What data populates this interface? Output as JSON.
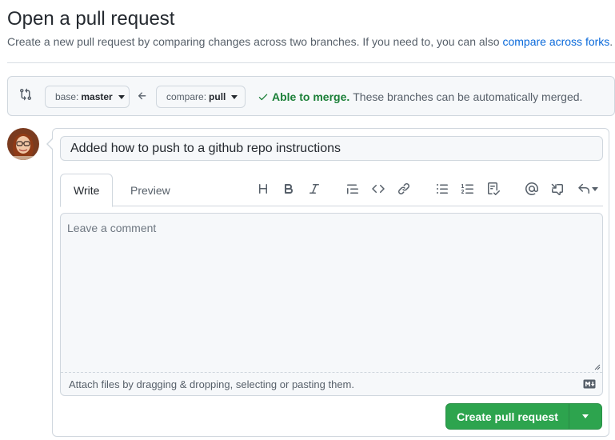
{
  "header": {
    "title": "Open a pull request",
    "subtitle": "Create a new pull request by comparing changes across two branches. If you need to, you can also ",
    "subtitle_link": "compare across forks",
    "subtitle_end": "."
  },
  "compare": {
    "base_prefix": "base: ",
    "base_branch": "master",
    "compare_prefix": "compare: ",
    "compare_branch": "pull",
    "merge_ok": "Able to merge.",
    "merge_detail": "These branches can be automatically merged."
  },
  "form": {
    "title_value": "Added how to push to a github repo instructions",
    "tabs": [
      "Write",
      "Preview"
    ],
    "comment_placeholder": "Leave a comment",
    "attach_text": "Attach files by dragging & dropping, selecting or pasting them.",
    "submit_label": "Create pull request"
  },
  "toolbar_icons": [
    "heading-icon",
    "bold-icon",
    "italic-icon",
    "quote-icon",
    "code-icon",
    "link-icon",
    "unordered-list-icon",
    "ordered-list-icon",
    "task-list-icon",
    "mention-icon",
    "cross-reference-icon",
    "saved-replies-icon"
  ],
  "colors": {
    "accent": "#0969da",
    "success": "#1a7f37",
    "button_green": "#2da44e",
    "border": "#d0d7de"
  }
}
